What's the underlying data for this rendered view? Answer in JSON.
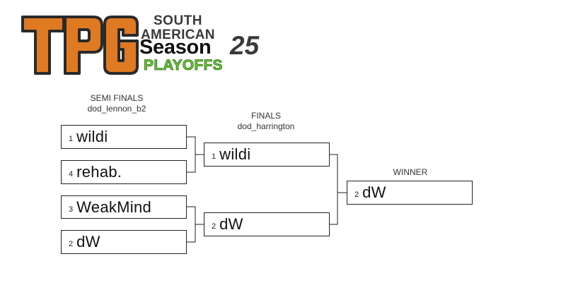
{
  "logo": {
    "letters": "TPG",
    "region_line1": "SOUTH",
    "region_line2": "AMERICAN",
    "season_word": "Season",
    "season_number": "25",
    "playoffs": "PLAYOFFS",
    "colors": {
      "orange": "#e07a22",
      "dark": "#2a2a2a",
      "green": "#6cc63a"
    }
  },
  "rounds": {
    "semi": {
      "title": "SEMI FINALS",
      "map": "dod_lennon_b2"
    },
    "final": {
      "title": "FINALS",
      "map": "dod_harrington"
    },
    "winner": {
      "title": "WINNER"
    }
  },
  "semi_matches": [
    {
      "top": {
        "seed": "1",
        "name": "wildi"
      },
      "bottom": {
        "seed": "4",
        "name": "rehab."
      }
    },
    {
      "top": {
        "seed": "3",
        "name": "WeakMind"
      },
      "bottom": {
        "seed": "2",
        "name": "dW"
      }
    }
  ],
  "final_match": {
    "top": {
      "seed": "1",
      "name": "wildi"
    },
    "bottom": {
      "seed": "2",
      "name": "dW"
    }
  },
  "champion": {
    "seed": "2",
    "name": "dW"
  }
}
